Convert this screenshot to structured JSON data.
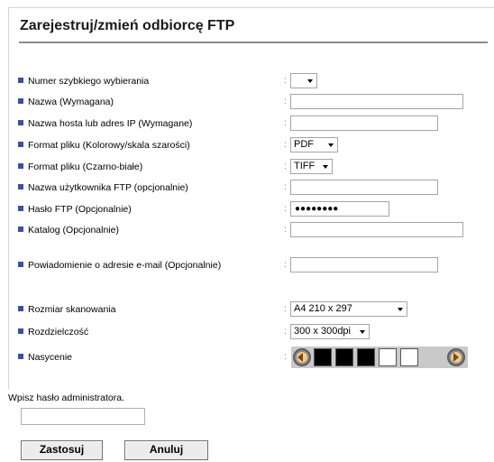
{
  "page": {
    "title": "Zarejestruj/zmień odbiorcę FTP"
  },
  "form": {
    "colon": ":",
    "fields": [
      {
        "id": "speed-dial",
        "label": "Numer szybkiego wybierania",
        "type": "select",
        "value": ""
      },
      {
        "id": "name",
        "label": "Nazwa (Wymagana)",
        "type": "text",
        "value": ""
      },
      {
        "id": "host",
        "label": "Nazwa hosta lub adres IP (Wymagane)",
        "type": "text",
        "value": ""
      },
      {
        "id": "format-color",
        "label": "Format pliku (Kolorowy/skala szarości)",
        "type": "select",
        "value": "PDF"
      },
      {
        "id": "format-bw",
        "label": "Format pliku (Czarno-białe)",
        "type": "select",
        "value": "TIFF"
      },
      {
        "id": "username",
        "label": "Nazwa użytkownika FTP (opcjonalnie)",
        "type": "text",
        "value": ""
      },
      {
        "id": "password",
        "label": "Hasło FTP (Opcjonalnie)",
        "type": "password",
        "value": "●●●●●●●●"
      },
      {
        "id": "directory",
        "label": "Katalog (Opcjonalnie)",
        "type": "text",
        "value": ""
      },
      {
        "id": "email-notify",
        "label": "Powiadomienie o adresie e-mail (Opcjonalnie)",
        "type": "text",
        "value": ""
      },
      {
        "id": "scan-size",
        "label": "Rozmiar skanowania",
        "type": "select",
        "value": "A4 210 x 297"
      },
      {
        "id": "resolution",
        "label": "Rozdzielczość",
        "type": "select",
        "value": "300 x 300dpi"
      },
      {
        "id": "saturation",
        "label": "Nasycenie",
        "type": "slider",
        "level_filled": 3,
        "level_total": 5
      }
    ]
  },
  "admin": {
    "label": "Wpisz hasło administratora.",
    "value": ""
  },
  "buttons": {
    "apply": "Zastosuj",
    "cancel": "Anuluj"
  },
  "colors": {
    "bullet": "#3d4f9f",
    "title_rule": "#8b8b8b",
    "saturation_filled": "#000000",
    "saturation_empty": "#ffffff"
  }
}
